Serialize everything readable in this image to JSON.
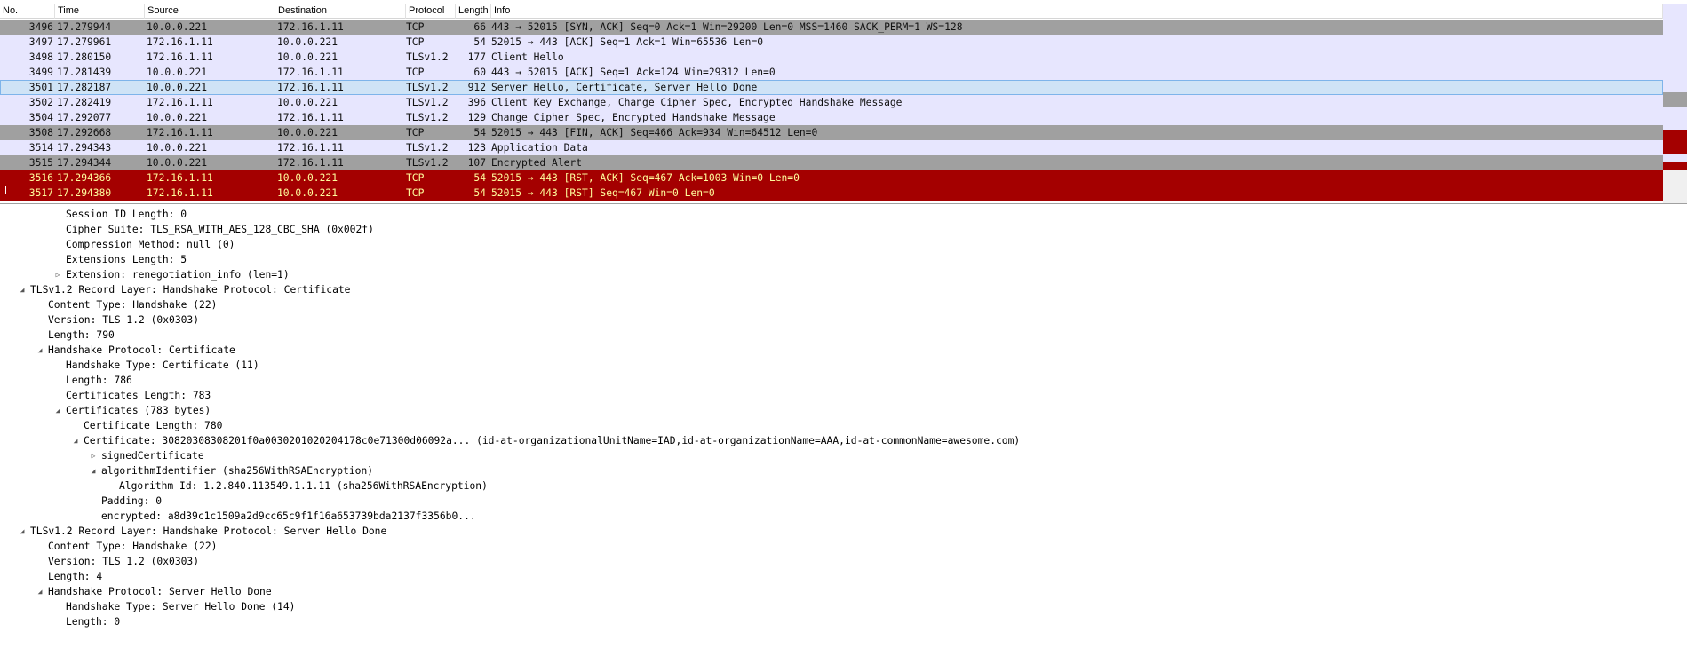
{
  "packet_list": {
    "columns": [
      "No.",
      "Time",
      "Source",
      "Destination",
      "Protocol",
      "Length",
      "Info"
    ],
    "rows": [
      {
        "no": "3496",
        "time": "17.279944",
        "src": "10.0.0.221",
        "dst": "172.16.1.11",
        "proto": "TCP",
        "len": "66",
        "info": "443 → 52015 [SYN, ACK] Seq=0 Ack=1 Win=29200 Len=0 MSS=1460 SACK_PERM=1 WS=128",
        "style": "gray"
      },
      {
        "no": "3497",
        "time": "17.279961",
        "src": "172.16.1.11",
        "dst": "10.0.0.221",
        "proto": "TCP",
        "len": "54",
        "info": "52015 → 443 [ACK] Seq=1 Ack=1 Win=65536 Len=0",
        "style": "lav"
      },
      {
        "no": "3498",
        "time": "17.280150",
        "src": "172.16.1.11",
        "dst": "10.0.0.221",
        "proto": "TLSv1.2",
        "len": "177",
        "info": "Client Hello",
        "style": "lav"
      },
      {
        "no": "3499",
        "time": "17.281439",
        "src": "10.0.0.221",
        "dst": "172.16.1.11",
        "proto": "TCP",
        "len": "60",
        "info": "443 → 52015 [ACK] Seq=1 Ack=124 Win=29312 Len=0",
        "style": "lav"
      },
      {
        "no": "3501",
        "time": "17.282187",
        "src": "10.0.0.221",
        "dst": "172.16.1.11",
        "proto": "TLSv1.2",
        "len": "912",
        "info": "Server Hello, Certificate, Server Hello Done",
        "style": "sel"
      },
      {
        "no": "3502",
        "time": "17.282419",
        "src": "172.16.1.11",
        "dst": "10.0.0.221",
        "proto": "TLSv1.2",
        "len": "396",
        "info": "Client Key Exchange, Change Cipher Spec, Encrypted Handshake Message",
        "style": "lav"
      },
      {
        "no": "3504",
        "time": "17.292077",
        "src": "10.0.0.221",
        "dst": "172.16.1.11",
        "proto": "TLSv1.2",
        "len": "129",
        "info": "Change Cipher Spec, Encrypted Handshake Message",
        "style": "lav"
      },
      {
        "no": "3508",
        "time": "17.292668",
        "src": "172.16.1.11",
        "dst": "10.0.0.221",
        "proto": "TCP",
        "len": "54",
        "info": "52015 → 443 [FIN, ACK] Seq=466 Ack=934 Win=64512 Len=0",
        "style": "gray"
      },
      {
        "no": "3514",
        "time": "17.294343",
        "src": "10.0.0.221",
        "dst": "172.16.1.11",
        "proto": "TLSv1.2",
        "len": "123",
        "info": "Application Data",
        "style": "lav"
      },
      {
        "no": "3515",
        "time": "17.294344",
        "src": "10.0.0.221",
        "dst": "172.16.1.11",
        "proto": "TLSv1.2",
        "len": "107",
        "info": "Encrypted Alert",
        "style": "gray"
      },
      {
        "no": "3516",
        "time": "17.294366",
        "src": "172.16.1.11",
        "dst": "10.0.0.221",
        "proto": "TCP",
        "len": "54",
        "info": "52015 → 443 [RST, ACK] Seq=467 Ack=1003 Win=0 Len=0",
        "style": "red"
      },
      {
        "no": "3517",
        "time": "17.294380",
        "src": "172.16.1.11",
        "dst": "10.0.0.221",
        "proto": "TCP",
        "len": "54",
        "info": "52015 → 443 [RST] Seq=467 Win=0 Len=0",
        "style": "red"
      }
    ],
    "colors": {
      "lavender": "#e7e6fe",
      "gray": "#a0a0a0",
      "selected": "#cfe3f6",
      "red_bg": "#a40000",
      "red_fg": "#fffc9c"
    }
  },
  "details": {
    "lines": [
      {
        "text": "Session ID Length: 0",
        "level": 4,
        "arrow": "none"
      },
      {
        "text": "Cipher Suite: TLS_RSA_WITH_AES_128_CBC_SHA (0x002f)",
        "level": 4,
        "arrow": "none"
      },
      {
        "text": "Compression Method: null (0)",
        "level": 4,
        "arrow": "none"
      },
      {
        "text": "Extensions Length: 5",
        "level": 4,
        "arrow": "none"
      },
      {
        "text": "Extension: renegotiation_info (len=1)",
        "level": 4,
        "arrow": "collapsed"
      },
      {
        "text": "TLSv1.2 Record Layer: Handshake Protocol: Certificate",
        "level": 2,
        "arrow": "expanded"
      },
      {
        "text": "Content Type: Handshake (22)",
        "level": 3,
        "arrow": "none"
      },
      {
        "text": "Version: TLS 1.2 (0x0303)",
        "level": 3,
        "arrow": "none"
      },
      {
        "text": "Length: 790",
        "level": 3,
        "arrow": "none"
      },
      {
        "text": "Handshake Protocol: Certificate",
        "level": 3,
        "arrow": "expanded"
      },
      {
        "text": "Handshake Type: Certificate (11)",
        "level": 4,
        "arrow": "none"
      },
      {
        "text": "Length: 786",
        "level": 4,
        "arrow": "none"
      },
      {
        "text": "Certificates Length: 783",
        "level": 4,
        "arrow": "none"
      },
      {
        "text": "Certificates (783 bytes)",
        "level": 4,
        "arrow": "expanded"
      },
      {
        "text": "Certificate Length: 780",
        "level": 5,
        "arrow": "none"
      },
      {
        "text": "Certificate: 30820308308201f0a0030201020204178c0e71300d06092a... (id-at-organizationalUnitName=IAD,id-at-organizationName=AAA,id-at-commonName=awesome.com)",
        "level": 5,
        "arrow": "expanded"
      },
      {
        "text": "signedCertificate",
        "level": 6,
        "arrow": "collapsed"
      },
      {
        "text": "algorithmIdentifier (sha256WithRSAEncryption)",
        "level": 6,
        "arrow": "expanded"
      },
      {
        "text": "Algorithm Id: 1.2.840.113549.1.1.11 (sha256WithRSAEncryption)",
        "level": 7,
        "arrow": "none"
      },
      {
        "text": "Padding: 0",
        "level": 6,
        "arrow": "none"
      },
      {
        "text": "encrypted: a8d39c1c1509a2d9cc65c9f1f16a653739bda2137f3356b0...",
        "level": 6,
        "arrow": "none"
      },
      {
        "text": "TLSv1.2 Record Layer: Handshake Protocol: Server Hello Done",
        "level": 2,
        "arrow": "expanded"
      },
      {
        "text": "Content Type: Handshake (22)",
        "level": 3,
        "arrow": "none"
      },
      {
        "text": "Version: TLS 1.2 (0x0303)",
        "level": 3,
        "arrow": "none"
      },
      {
        "text": "Length: 4",
        "level": 3,
        "arrow": "none"
      },
      {
        "text": "Handshake Protocol: Server Hello Done",
        "level": 3,
        "arrow": "expanded"
      },
      {
        "text": "Handshake Type: Server Hello Done (14)",
        "level": 4,
        "arrow": "none"
      },
      {
        "text": "Length: 0",
        "level": 4,
        "arrow": "none"
      }
    ]
  }
}
